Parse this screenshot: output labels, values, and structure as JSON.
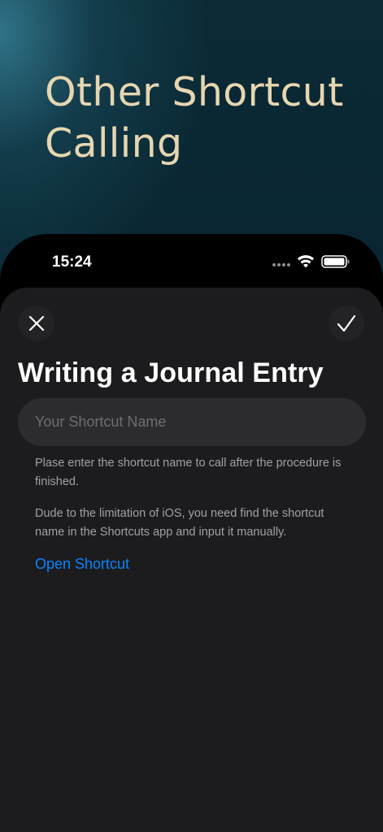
{
  "promo": {
    "title": "Other Shortcut Calling"
  },
  "status_bar": {
    "time": "15:24",
    "icons": [
      "cellular-dots-icon",
      "wifi-icon",
      "battery-icon"
    ]
  },
  "sheet": {
    "close_icon": "close-icon",
    "confirm_icon": "checkmark-icon",
    "title": "Writing a Journal Entry",
    "input": {
      "placeholder": "Your Shortcut Name",
      "value": ""
    },
    "help_text_1": "Plase enter the shortcut name to call after the procedure is finished.",
    "help_text_2": "Dude to the limitation of iOS, you need find the shortcut name in the Shortcuts app and input it manually.",
    "open_link": "Open Shortcut"
  },
  "colors": {
    "promo_text": "#e6d6b0",
    "sheet_bg": "#1c1c1e",
    "input_bg": "#2c2c2e",
    "link": "#0a84ff",
    "secondary_text": "#a1a1a6"
  }
}
